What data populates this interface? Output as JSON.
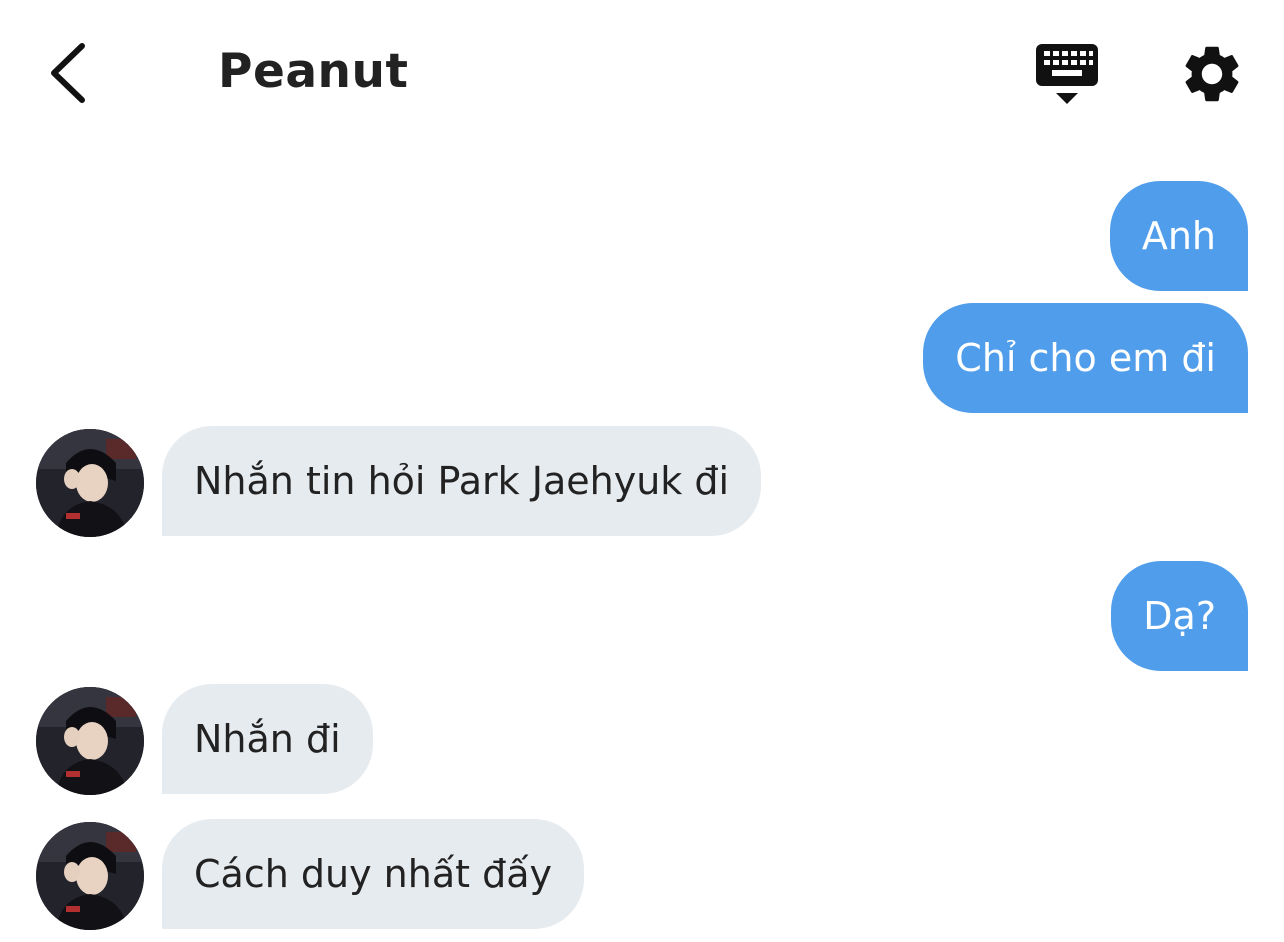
{
  "header": {
    "back_icon": "chevron-left-icon",
    "title": "Peanut",
    "keyboard_icon": "keyboard-hide-icon",
    "settings_icon": "gear-icon"
  },
  "messages": [
    {
      "from": "me",
      "text": "Anh"
    },
    {
      "from": "me",
      "text": "Chỉ cho em đi"
    },
    {
      "from": "contact",
      "text": "Nhắn tin hỏi Park Jaehyuk đi"
    },
    {
      "from": "me",
      "text": "Dạ?"
    },
    {
      "from": "contact",
      "text": "Nhắn đi"
    },
    {
      "from": "contact",
      "text": "Cách duy nhất đấy"
    }
  ],
  "colors": {
    "sent_bubble": "#4f9deb",
    "received_bubble": "#e6ebf0",
    "text_dark": "#222222"
  }
}
